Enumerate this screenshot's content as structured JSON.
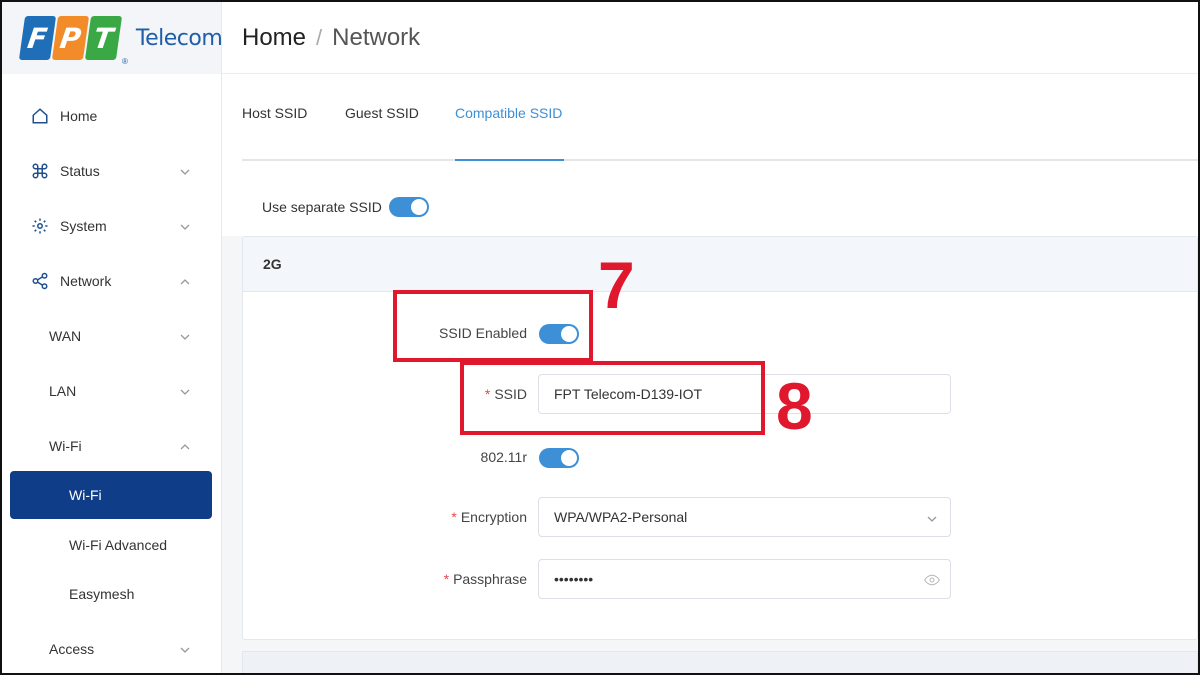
{
  "brand": {
    "logo_letters": [
      "F",
      "P",
      "T"
    ],
    "logo_name": "Telecom",
    "registered_mark": "®"
  },
  "sidebar": {
    "items": [
      {
        "label": "Home",
        "icon": "home-icon"
      },
      {
        "label": "Status",
        "icon": "command-icon"
      },
      {
        "label": "System",
        "icon": "gear-icon"
      },
      {
        "label": "Network",
        "icon": "share-icon"
      },
      {
        "label": "WAN"
      },
      {
        "label": "LAN"
      },
      {
        "label": "Wi-Fi"
      },
      {
        "label": "Wi-Fi",
        "active": true
      },
      {
        "label": "Wi-Fi Advanced"
      },
      {
        "label": "Easymesh"
      },
      {
        "label": "Access"
      }
    ]
  },
  "header": {
    "breadcrumb_home": "Home",
    "breadcrumb_sep": "/",
    "breadcrumb_current": "Network"
  },
  "tabs": [
    {
      "label": "Host SSID"
    },
    {
      "label": "Guest SSID"
    },
    {
      "label": "Compatible SSID",
      "active": true
    }
  ],
  "separate_ssid": {
    "label": "Use separate SSID",
    "enabled": true
  },
  "panel_2g": {
    "title": "2G",
    "ssid_enabled_label": "SSID Enabled",
    "ssid_enabled": true,
    "required_mark": "*",
    "ssid_label": "SSID",
    "ssid_value": "FPT Telecom-D139-IOT",
    "r80211_label": "802.11r",
    "r80211_enabled": true,
    "encryption_label": "Encryption",
    "encryption_value": "WPA/WPA2-Personal",
    "passphrase_label": "Passphrase",
    "passphrase_value": "••••••••"
  },
  "annotations": {
    "step7": "7",
    "step8": "8"
  },
  "colors": {
    "accent": "#3d8fd6",
    "sidebar_active": "#0f3d88",
    "annotation_red": "#e0182d",
    "logo_blue": "#1f6fb8",
    "logo_orange": "#f28c28",
    "logo_green": "#3aa845"
  }
}
